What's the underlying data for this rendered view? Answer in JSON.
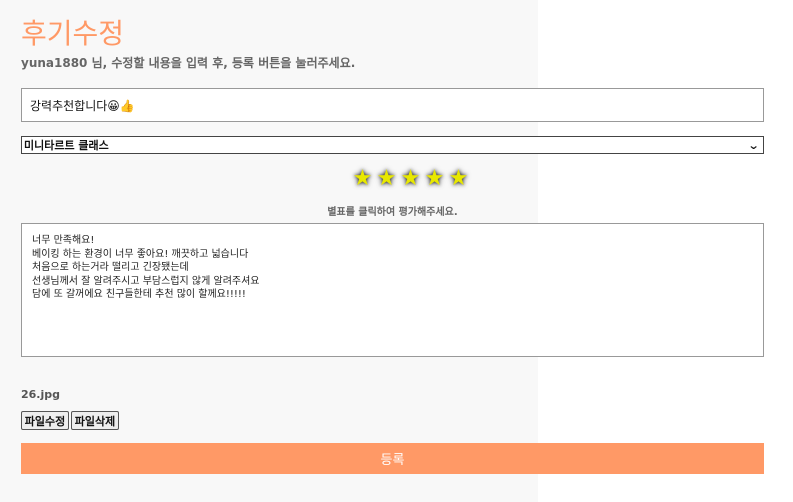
{
  "header": {
    "title": "후기수정",
    "subtitle": "yuna1880 님, 수정할 내용을 입력 후, 등록 버튼을 눌러주세요."
  },
  "form": {
    "title_value": "강력추천합니다😀👍",
    "class_select": {
      "selected": "미니타르트 클래스"
    },
    "rating": {
      "stars": 5,
      "max": 5,
      "help_text": "별표를 클릭하여 평가해주세요."
    },
    "content_value": "너무 만족해요!\n베이킹 하는 환경이 너무 좋아요! 깨끗하고 넓습니다\n처음으로 하는거라 떨리고 긴장됐는데\n선생님께서 잘 알려주시고 부담스럽지 않게 알려주셔요\n담에 또 갈꺼에요 친구들한테 추천 많이 할께요!!!!!",
    "file": {
      "name": "26.jpg",
      "edit_label": "파일수정",
      "delete_label": "파일삭제"
    },
    "submit_label": "등록"
  },
  "colors": {
    "accent": "#ff9966",
    "star": "#e8e800"
  },
  "icons": {
    "star": "star-icon",
    "select_arrow": "chevron-down-icon"
  }
}
